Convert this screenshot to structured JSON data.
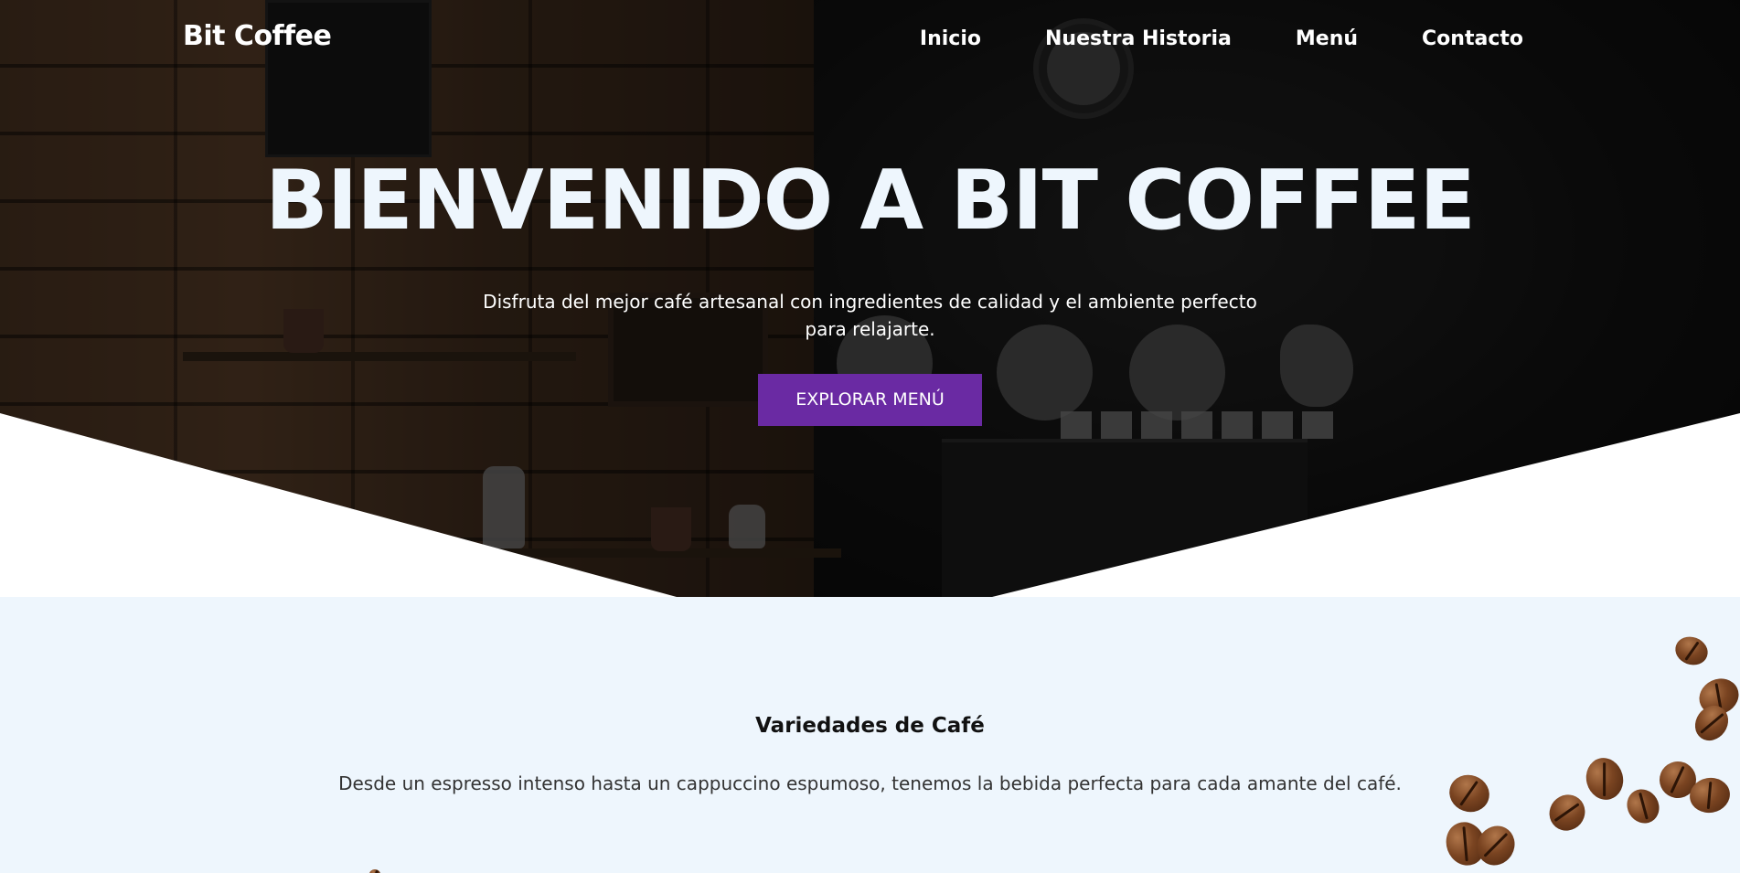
{
  "nav": {
    "logo": "Bit Coffee",
    "links": [
      {
        "label": "Inicio"
      },
      {
        "label": "Nuestra Historia"
      },
      {
        "label": "Menú"
      },
      {
        "label": "Contacto"
      }
    ]
  },
  "hero": {
    "title": "BIENVENIDO A BIT COFFEE",
    "subtitle": "Disfruta del mejor café artesanal con ingredientes de calidad y el ambiente perfecto para relajarte.",
    "cta_label": "EXPLORAR MENÚ"
  },
  "section": {
    "title": "Variedades de Café",
    "text": "Desde un espresso intenso hasta un cappuccino espumoso, tenemos la bebida perfecta para cada amante del café."
  },
  "colors": {
    "accent": "#6a2aa3",
    "section_bg": "#eef6fd",
    "hero_title": "#eef6fd"
  }
}
